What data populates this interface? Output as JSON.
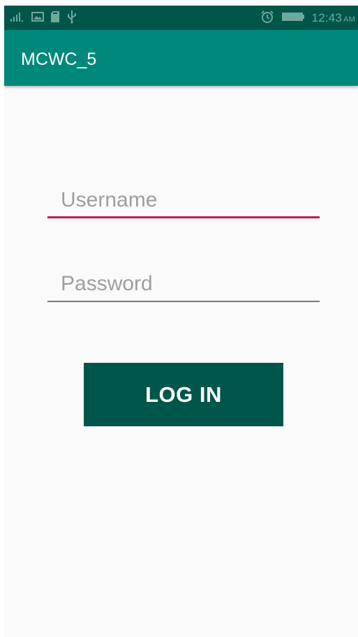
{
  "status_bar": {
    "time": "12:43",
    "ampm": "AM",
    "icons": [
      "signal-icon",
      "image-icon",
      "sd-card-icon",
      "usb-icon",
      "alarm-icon",
      "battery-icon"
    ]
  },
  "app_bar": {
    "title": "MCWC_5"
  },
  "form": {
    "username_placeholder": "Username",
    "username_value": "",
    "password_placeholder": "Password",
    "password_value": "",
    "login_label": "LOG IN"
  },
  "colors": {
    "status_bar": "#00564a",
    "app_bar": "#00897b",
    "accent": "#c2185b",
    "button": "#00564a",
    "background": "#fafafa"
  }
}
